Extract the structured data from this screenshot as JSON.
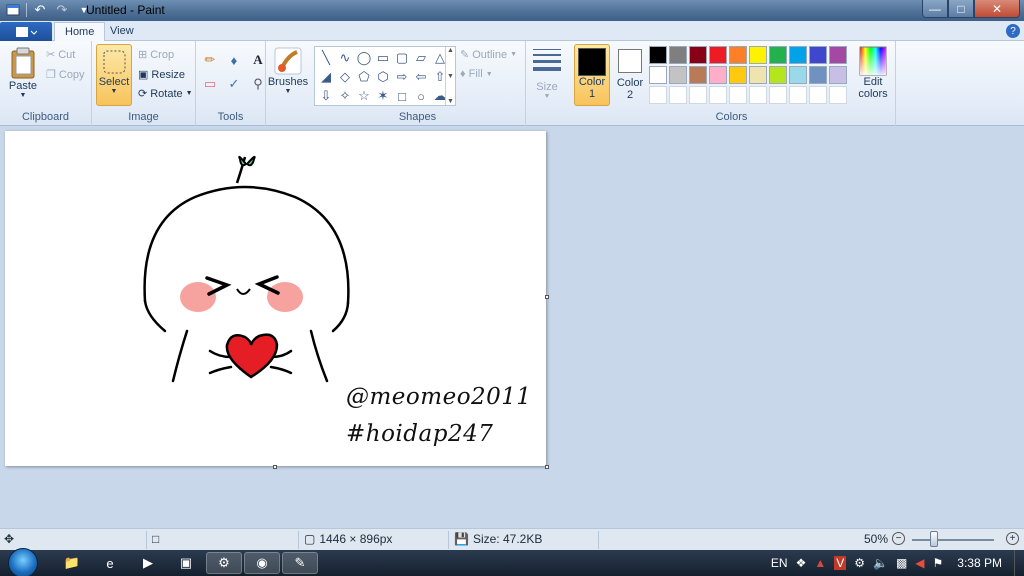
{
  "app": {
    "title": "Untitled - Paint"
  },
  "window_buttons": {
    "minimize": "—",
    "maximize": "□",
    "close": "✕"
  },
  "tabs": [
    {
      "label": "Home",
      "active": true
    },
    {
      "label": "View",
      "active": false
    }
  ],
  "help_label": "?",
  "ribbon": {
    "clipboard": {
      "group_label": "Clipboard",
      "paste": "Paste",
      "cut": "Cut",
      "copy": "Copy"
    },
    "image": {
      "group_label": "Image",
      "select": "Select",
      "crop": "Crop",
      "resize": "Resize",
      "rotate": "Rotate"
    },
    "tools": {
      "group_label": "Tools",
      "text_tool": "A"
    },
    "brushes": {
      "label": "Brushes"
    },
    "shapes": {
      "group_label": "Shapes",
      "outline": "Outline",
      "fill": "Fill"
    },
    "size": {
      "label": "Size"
    },
    "colors": {
      "group_label": "Colors",
      "color1_label_line1": "Color",
      "color1_label_line2": "1",
      "color2_label_line1": "Color",
      "color2_label_line2": "2",
      "edit_colors_line1": "Edit",
      "edit_colors_line2": "colors",
      "color1": "#000000",
      "color2": "#ffffff",
      "palette_row1": [
        "#000000",
        "#7f7f7f",
        "#880015",
        "#ed1c24",
        "#ff7f27",
        "#fff200",
        "#22b14c",
        "#00a2e8",
        "#3f48cc",
        "#a349a4"
      ],
      "palette_row2": [
        "#ffffff",
        "#c3c3c3",
        "#b97a57",
        "#ffaec9",
        "#ffc90e",
        "#efe4b0",
        "#b5e61d",
        "#99d9ea",
        "#7092be",
        "#c8bfe7"
      ]
    }
  },
  "canvas": {
    "handle_text": "@meomeo2011",
    "hashtag_text": "#hoidap247"
  },
  "status": {
    "dimensions": "1446 × 896px",
    "size": "Size: 47.2KB",
    "zoom": "50%"
  },
  "taskbar": {
    "language": "EN",
    "time": "3:38 PM"
  }
}
